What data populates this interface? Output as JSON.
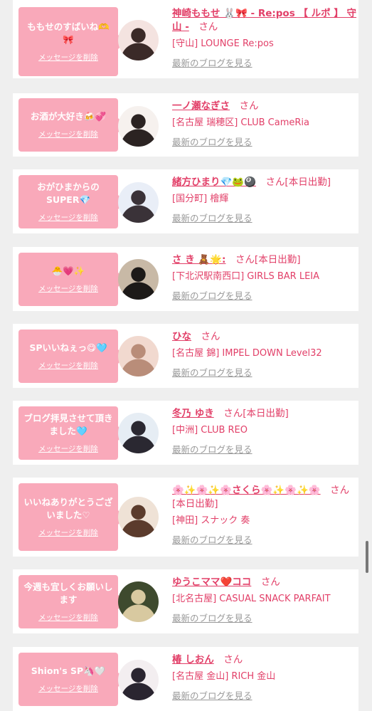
{
  "common": {
    "delete_label": "メッセージを削除",
    "blog_label": "最新のブログを見る"
  },
  "items": [
    {
      "message": "ももせのすばいね🫶🎀",
      "name": "神崎ももせ 🐰🎀 - Re:pos 【 ルポ 】 守山 -",
      "suffix": "さん",
      "shop": "[守山] LOUNGE Re:pos",
      "avatar_colors": [
        "#f4e3e0",
        "#3b2a28"
      ]
    },
    {
      "message": "お酒が大好き🍻💞",
      "name": "一ノ瀬なぎさ",
      "suffix": "さん",
      "shop": "[名古屋 瑞穂区] CLUB CameRia",
      "avatar_colors": [
        "#f6f1ee",
        "#2b2322"
      ]
    },
    {
      "message": "おがひまからのSUPER💎",
      "name": "緒方ひまり💎🐸🎱",
      "suffix": "さん[本日出勤]",
      "shop": "[国分町] 檜輝",
      "avatar_colors": [
        "#e9eef7",
        "#3a3238"
      ]
    },
    {
      "message": "🐣💗✨",
      "name": "さ き 🧸🌟:",
      "suffix": "さん[本日出勤]",
      "shop": "[下北沢駅南西口] GIRLS BAR LEIA",
      "avatar_colors": [
        "#c8b9a6",
        "#1d1a18"
      ]
    },
    {
      "message": "SPいいねぇっ😋🩵",
      "name": "ひな",
      "suffix": "さん",
      "shop": "[名古屋 錦] IMPEL DOWN Level32",
      "avatar_colors": [
        "#f1d9cf",
        "#b98d79"
      ]
    },
    {
      "message": "ブログ拝見させて頂きました🩵",
      "name": "冬乃 ゆき",
      "suffix": "さん[本日出勤]",
      "shop": "[中洲] CLUB REO",
      "avatar_colors": [
        "#e6edf4",
        "#2a2831"
      ]
    },
    {
      "message": "いいねありがとうございました♡",
      "name": "🌸✨🌸✨🌸さくら🌸✨🌸✨🌸",
      "suffix": "さん[本日出勤]",
      "shop": "[神田] スナック 奏",
      "avatar_colors": [
        "#efe2d6",
        "#5b3b2c"
      ]
    },
    {
      "message": "今週も宜しくお願いします",
      "name": "ゆうこママ❤️ココ",
      "suffix": "さん",
      "shop": "[北名古屋] CASUAL SNACK PARFAIT",
      "avatar_colors": [
        "#3e4a2e",
        "#d8c9a0"
      ]
    },
    {
      "message": "Shion's SP🦄🤍",
      "name": "椿 しおん",
      "suffix": "さん",
      "shop": "[名古屋 金山] RICH 金山",
      "avatar_colors": [
        "#f3eef0",
        "#2a2530"
      ]
    }
  ]
}
